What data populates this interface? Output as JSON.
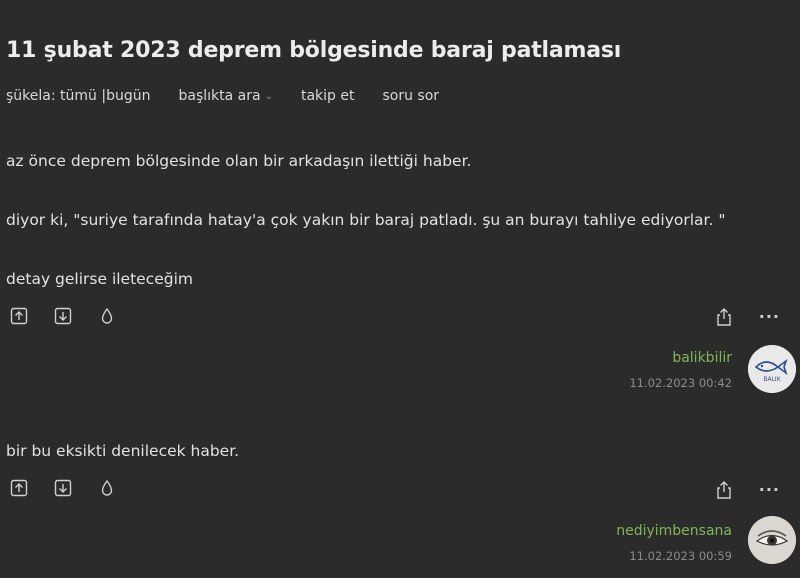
{
  "topic": {
    "title": "11 şubat 2023 deprem bölgesinde baraj patlaması"
  },
  "subnav": {
    "sukela_prefix": "şükela:",
    "sukela_all": "tümü",
    "sukela_sep": "|",
    "sukela_today": "bugün",
    "search_in_title": "başlıkta ara",
    "follow": "takip et",
    "ask": "soru sor"
  },
  "entries": [
    {
      "paragraphs": [
        "az önce deprem bölgesinde olan bir arkadaşın ilettiği haber.",
        "diyor ki, \"suriye tarafında hatay'a çok yakın bir baraj patladı. şu an burayı tahliye ediyorlar. \"",
        "detay gelirse ileteceğim"
      ],
      "author": "balikbilir",
      "date": "11.02.2023 00:42",
      "avatar_text": "BALIK"
    },
    {
      "paragraphs": [
        "bir bu eksikti denilecek haber."
      ],
      "author": "nediyimbensana",
      "date": "11.02.2023 00:59"
    }
  ],
  "icons": {
    "upvote": "arrow-up-box-icon",
    "downvote": "arrow-down-box-icon",
    "favorite": "drop-icon",
    "share": "share-icon",
    "more": "more-dots-icon"
  },
  "ui": {
    "more_label": "···",
    "caret": "⌄"
  },
  "colors": {
    "background": "#2b2b2b",
    "text": "#e2e2e2",
    "author": "#7fb55a",
    "date": "#8c8c8c"
  }
}
